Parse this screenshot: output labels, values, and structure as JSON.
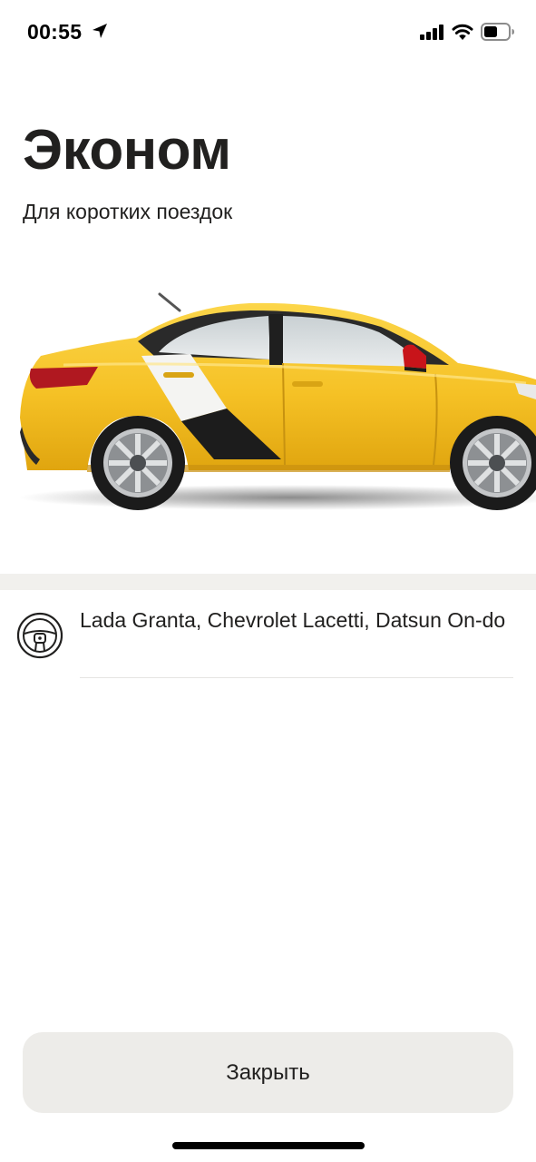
{
  "status_bar": {
    "time": "00:55",
    "icons": [
      "location-arrow-icon",
      "cellular-signal-icon",
      "wifi-icon",
      "battery-icon"
    ]
  },
  "tariff": {
    "title": "Эконом",
    "subtitle": "Для коротких поездок"
  },
  "car_models": {
    "icon": "steering-wheel-icon",
    "text": "Lada Granta, Chevrolet Lacetti, Datsun On-do"
  },
  "actions": {
    "close_label": "Закрыть"
  },
  "colors": {
    "car_body": "#f5c125",
    "button_bg": "#edece9",
    "divider_band": "#f1f0ed",
    "text": "#21201f"
  }
}
